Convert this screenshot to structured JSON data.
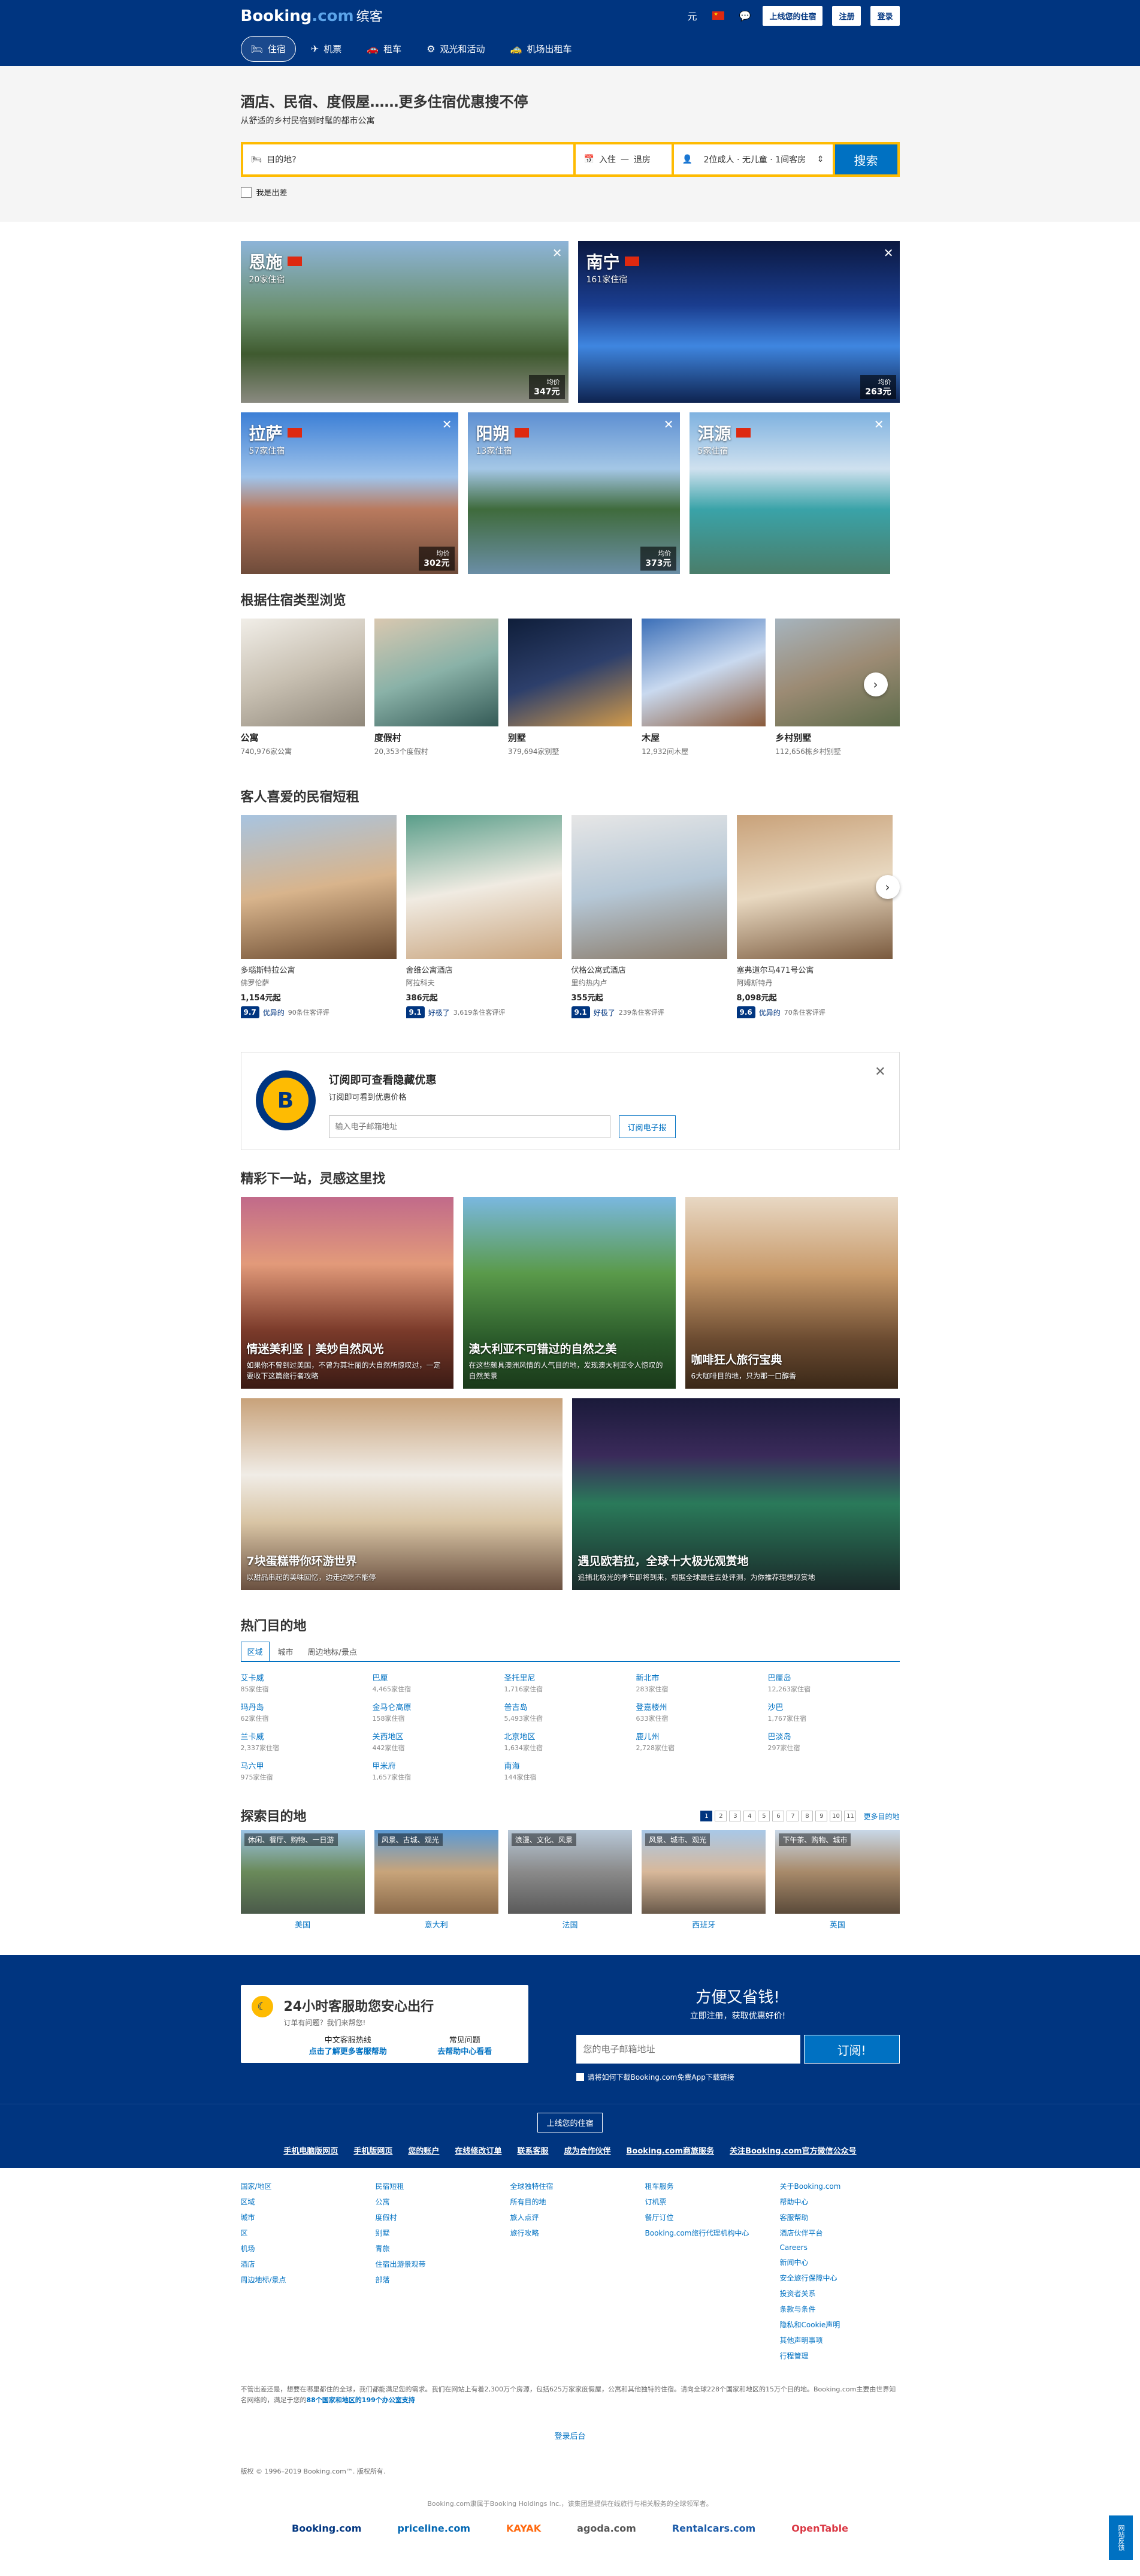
{
  "header": {
    "logo_main": "Booking",
    "logo_dot": ".com",
    "logo_suffix": "缤客",
    "currency": "元",
    "list_property": "上线您的住宿",
    "register": "注册",
    "signin": "登录",
    "nav": [
      {
        "label": "住宿",
        "icon": "bed-icon",
        "glyph": "🛏"
      },
      {
        "label": "机票",
        "icon": "plane-icon",
        "glyph": "✈"
      },
      {
        "label": "租车",
        "icon": "car-icon",
        "glyph": "🚗"
      },
      {
        "label": "观光和活动",
        "icon": "attractions-icon",
        "glyph": "⚙"
      },
      {
        "label": "机场出租车",
        "icon": "taxi-icon",
        "glyph": "🚕"
      }
    ]
  },
  "hero": {
    "title": "酒店、民宿、度假屋……更多住宿优惠搜不停",
    "subtitle": "从舒适的乡村民宿到时髦的都市公寓",
    "search": {
      "destination_placeholder": "目的地?",
      "checkin": "入住",
      "arrow": "—",
      "checkout": "退房",
      "guests": "2位成人 · 无儿童 · 1间客房",
      "button": "搜索"
    },
    "business": "我是出差"
  },
  "cities": [
    {
      "name": "恩施",
      "count": "20家住宿",
      "price_label": "均价",
      "price": "347元"
    },
    {
      "name": "南宁",
      "count": "161家住宿",
      "price_label": "均价",
      "price": "263元"
    },
    {
      "name": "拉萨",
      "count": "57家住宿",
      "price_label": "均价",
      "price": "302元"
    },
    {
      "name": "阳朔",
      "count": "13家住宿",
      "price_label": "均价",
      "price": "373元"
    },
    {
      "name": "洱源",
      "count": "5家住宿",
      "price_label": "均价",
      "price": ""
    }
  ],
  "types_title": "根据住宿类型浏览",
  "types": [
    {
      "name": "公寓",
      "count": "740,976家公寓"
    },
    {
      "name": "度假村",
      "count": "20,353个度假村"
    },
    {
      "name": "别墅",
      "count": "379,694家别墅"
    },
    {
      "name": "木屋",
      "count": "12,932间木屋"
    },
    {
      "name": "乡村别墅",
      "count": "112,656栋乡村别墅"
    }
  ],
  "homes_title": "客人喜爱的民宿短租",
  "homes": [
    {
      "name": "多瑙斯特拉公寓",
      "loc": "佛罗伦萨",
      "price": "1,154元起",
      "score": "9.7",
      "word": "优异的",
      "reviews": "90条住客评评"
    },
    {
      "name": "舍维公寓酒店",
      "loc": "阿拉科夫",
      "price": "386元起",
      "score": "9.1",
      "word": "好极了",
      "reviews": "3,619条住客评评"
    },
    {
      "name": "伏格公寓式酒店",
      "loc": "里约热内卢",
      "price": "355元起",
      "score": "9.1",
      "word": "好极了",
      "reviews": "239条住客评评"
    },
    {
      "name": "塞弗道尔马471号公寓",
      "loc": "阿姆斯特丹",
      "price": "8,098元起",
      "score": "9.6",
      "word": "优异的",
      "reviews": "70条住客评评"
    }
  ],
  "subscribe": {
    "title": "订阅即可查看隐藏优惠",
    "desc": "订阅即可看到优惠价格",
    "placeholder": "输入电子邮箱地址",
    "button": "订阅电子报"
  },
  "insp_title": "精彩下一站，灵感这里找",
  "inspiration": [
    {
      "title": "情迷美利坚 | 美妙自然风光",
      "desc": "如果你不曾到过美国，不曾为其壮丽的大自然所惊叹过，一定要收下这篇旅行者攻略"
    },
    {
      "title": "澳大利亚不可错过的自然之美",
      "desc": "在这些颇具澳洲风情的人气目的地，发现澳大利亚令人惊叹的自然美景"
    },
    {
      "title": "咖啡狂人旅行宝典",
      "desc": "6大咖啡目的地，只为那一口醇香"
    },
    {
      "title": "7块蛋糕带你环游世界",
      "desc": "以甜品串起的美味回忆，边走边吃不能停"
    },
    {
      "title": "遇见欧若拉，全球十大极光观赏地",
      "desc": "追捕北极光的季节即将到来，根据全球最佳去处评测，为你推荐理想观赏地"
    }
  ],
  "popular_title": "热门目的地",
  "popular_tabs": [
    "区域",
    "城市",
    "周边地标/景点"
  ],
  "popular": [
    {
      "name": "艾卡威",
      "count": "85家住宿"
    },
    {
      "name": "巴厘",
      "count": "4,465家住宿"
    },
    {
      "name": "圣托里尼",
      "count": "1,716家住宿"
    },
    {
      "name": "新北市",
      "count": "283家住宿"
    },
    {
      "name": "巴厘岛",
      "count": "12,263家住宿"
    },
    {
      "name": "玛丹岛",
      "count": "62家住宿"
    },
    {
      "name": "金马仑高原",
      "count": "158家住宿"
    },
    {
      "name": "普吉岛",
      "count": "5,493家住宿"
    },
    {
      "name": "登嘉楼州",
      "count": "633家住宿"
    },
    {
      "name": "沙巴",
      "count": "1,767家住宿"
    },
    {
      "name": "兰卡威",
      "count": "2,337家住宿"
    },
    {
      "name": "关西地区",
      "count": "442家住宿"
    },
    {
      "name": "北京地区",
      "count": "1,634家住宿"
    },
    {
      "name": "鹿儿州",
      "count": "2,728家住宿"
    },
    {
      "name": "巴淡岛",
      "count": "297家住宿"
    },
    {
      "name": "马六甲",
      "count": "975家住宿"
    },
    {
      "name": "甲米府",
      "count": "1,657家住宿"
    },
    {
      "name": "南海",
      "count": "144家住宿"
    }
  ],
  "explore_title": "探索目的地",
  "pages": [
    "1",
    "2",
    "3",
    "4",
    "5",
    "6",
    "7",
    "8",
    "9",
    "10",
    "11"
  ],
  "more_countries": "更多目的地",
  "explore": [
    {
      "tag": "休闲、餐厅、购物、一日游",
      "country": "美国"
    },
    {
      "tag": "风景、古城、观光",
      "country": "意大利"
    },
    {
      "tag": "浪漫、文化、风景",
      "country": "法国"
    },
    {
      "tag": "风景、城市、观光",
      "country": "西班牙"
    },
    {
      "tag": "下午茶、购物、城市",
      "country": "英国"
    }
  ],
  "footer": {
    "help_title": "24小时客服助您安心出行",
    "help_sub": "订单有问题？我们来帮您!",
    "help_col1_label": "中文客服热线",
    "help_col1_link": "点击了解更多客服帮助",
    "help_col2_label": "常见问题",
    "help_col2_link": "去帮助中心看看",
    "promo_title": "方便又省钱!",
    "promo_sub": "立即注册，获取优惠好价!",
    "promo_placeholder": "您的电子邮箱地址",
    "promo_btn": "订阅!",
    "promo_chk": "请将如何下载Booking.com免费App下载链接",
    "list_property": "上线您的住宿",
    "top_links": [
      "手机电脑版网页",
      "手机版网页",
      "您的账户",
      "在线修改订单",
      "联系客服",
      "成为合作伙伴",
      "Booking.com商旅服务",
      "关注Booking.com官方微信公众号"
    ],
    "cols": [
      [
        "国家/地区",
        "区域",
        "城市",
        "区",
        "机场",
        "酒店",
        "周边地标/景点"
      ],
      [
        "民宿短租",
        "公寓",
        "度假村",
        "别墅",
        "青旅",
        "住宿出游景观带",
        "部落"
      ],
      [
        "全球独特住宿",
        "所有目的地",
        "旅人点评",
        "旅行攻略"
      ],
      [
        "租车服务",
        "订机票",
        "餐厅订位",
        "Booking.com旅行代理机构中心"
      ],
      [
        "关于Booking.com",
        "帮助中心",
        "客服帮助",
        "酒店伙伴平台",
        "Careers",
        "新闻中心",
        "安全旅行保障中心",
        "投资者关系",
        "条款与条件",
        "隐私和Cookie声明",
        "其他声明事项",
        "行程管理"
      ]
    ],
    "note": "不管出差还是，想要在哪里都住的全球，我们都能满足您的需求。我们在网站上有着2,300万个房源，包括625万家家度假屋，公寓和其他独特的住宿。请向全球228个国家和地区的15万个目的地。Booking.com主要由世界知名网络的，满足于您的",
    "note_hl": "88个国家和地区的199个办公室支持",
    "admin": "登录后台",
    "copyright": "版权 © 1996–2019 Booking.com™. 版权所有.",
    "bottom": "Booking.com隶属于Booking Holdings Inc.，该集团是提供在线旅行与相关服务的全球领军者。",
    "brands": [
      "Booking.com",
      "priceline.com",
      "KAYAK",
      "agoda.com",
      "Rentalcars.com",
      "OpenTable"
    ],
    "feedback": "网站反馈"
  },
  "colors": {
    "primary": "#003580",
    "accent": "#febb02",
    "link": "#0071c2"
  }
}
